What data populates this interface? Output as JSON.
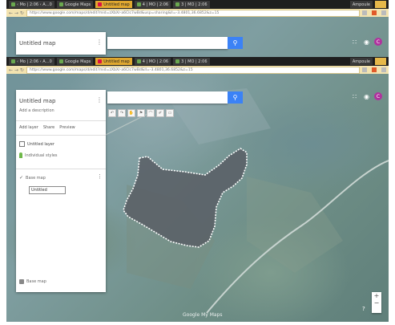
{
  "browser": {
    "tabs": [
      {
        "label": "‹ Mo | 2:06 ‹ A…0",
        "active": false
      },
      {
        "label": "Google Maps",
        "active": false
      },
      {
        "label": "Untitled map",
        "active": true
      },
      {
        "label": "4 | MO | 2:06",
        "active": false
      },
      {
        "label": "3 | MO | 2:06",
        "active": false
      }
    ],
    "user_label": "Ampoule",
    "url": "https://www.google.com/maps/d/edit?mid=zXbXr-a6Clc7wBd&usp=sharing&ll=-3.4801,36.6852&z=15",
    "url_secondary": "https://www.google.com/maps/d/edit?mid=zXbXr-a6Clc7wBd&ll=-3.4801,36.6852&z=15"
  },
  "map": {
    "title": "Untitled map",
    "description": "Add a description",
    "menu_glyph": "⋮",
    "actions": {
      "add_layer": "Add layer",
      "share": "Share",
      "preview": "Preview"
    },
    "layer": {
      "name": "Untitled layer",
      "style": "Individual styles",
      "item_label": "Untitled",
      "base_layer": "Base map"
    },
    "search_placeholder": "",
    "search_icon": "search-icon",
    "toolbar": [
      "↶",
      "↷",
      "✋",
      "⚑",
      "⌒",
      "✐",
      "▭"
    ],
    "attribution": "Google My Maps",
    "help": "?",
    "zoom_in": "+",
    "zoom_out": "−",
    "header_icons": [
      "apps-grid-icon",
      "account-icon"
    ],
    "header_icon_glyphs": [
      "∷",
      "◉"
    ],
    "avatar_letter": "C"
  },
  "colors": {
    "accent": "#3b82f6",
    "tab_active": "#e0a830",
    "polygon_fill": "#5a6066",
    "avatar": "#b0329e"
  }
}
